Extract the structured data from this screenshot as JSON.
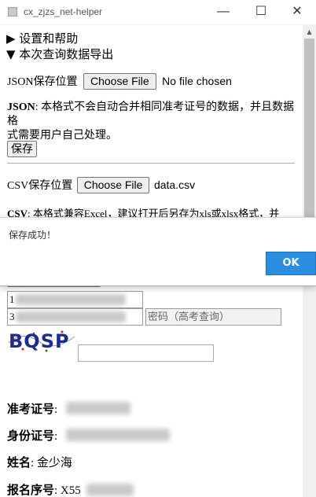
{
  "window": {
    "title": "cx_zjzs_net-helper",
    "minimize": "—",
    "maximize": "☐",
    "close": "✕"
  },
  "sections": {
    "settings": "▶ 设置和帮助",
    "export": "▼ 本次查询数据导出"
  },
  "json_export": {
    "label": "JSON保存位置",
    "choose_button": "Choose File",
    "file_status": "No file chosen",
    "desc_bold": "JSON",
    "desc_line1": ": 本格式不会自动合并相同准考证号的数据，并且数据格",
    "desc_line2": "式需要用户自己处理。",
    "save_button": "保存"
  },
  "csv_export": {
    "label": "CSV保存位置",
    "choose_button": "Choose File",
    "file_status": "data.csv",
    "desc_bold": "CSV",
    "desc_line1": ": 本格式兼容Excel，建议打开后另存为xls或xlsx格式，并"
  },
  "dialog": {
    "message": "保存成功！",
    "ok_button": "OK"
  },
  "query_form": {
    "field1_value": "1",
    "field2_value": "3",
    "password_placeholder": "密码（高考查询）",
    "captcha_text": "BQSP"
  },
  "results": {
    "exam_id_label": "准考证号",
    "id_card_label": "身份证号",
    "name_label": "姓名",
    "name_value": ": 金少海",
    "reg_no_label": "报名序号",
    "reg_no_value": ": X55"
  },
  "colors": {
    "ok_button": "#2a8fe0",
    "scroll_thumb": "#c1c1c1"
  }
}
